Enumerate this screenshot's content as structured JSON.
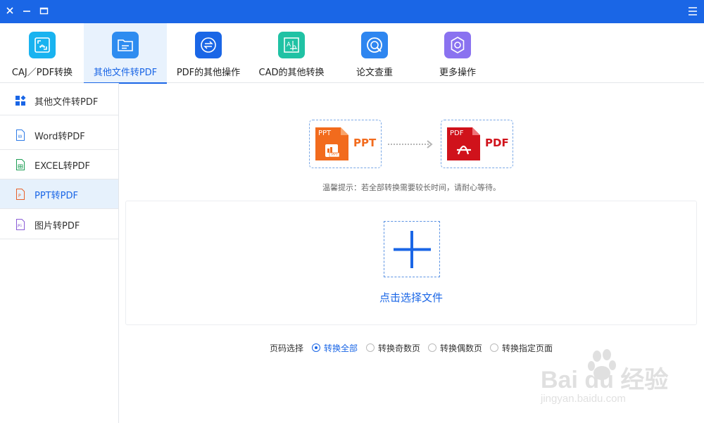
{
  "titlebar": {
    "background": "#1a66e6"
  },
  "toolbar": {
    "items": [
      {
        "label": "CAJ／PDF转换",
        "icon": "caj-pdf-convert-icon",
        "color": "#19b3f0"
      },
      {
        "label": "其他文件转PDF",
        "icon": "folder-file-icon",
        "color": "#2e8cf0",
        "active": true
      },
      {
        "label": "PDF的其他操作",
        "icon": "swap-arrows-icon",
        "color": "#1a66e6"
      },
      {
        "label": "CAD的其他转换",
        "icon": "cad-drawing-icon",
        "color": "#20c2a4"
      },
      {
        "label": "论文查重",
        "icon": "search-check-icon",
        "color": "#2e86f0"
      },
      {
        "label": "更多操作",
        "icon": "gear-icon",
        "color": "#8a72f0"
      }
    ]
  },
  "sidebar": {
    "items": [
      {
        "label": "其他文件转PDF",
        "icon": "grid-apps-icon"
      },
      {
        "label": "Word转PDF",
        "icon": "word-file-icon"
      },
      {
        "label": "EXCEL转PDF",
        "icon": "excel-file-icon"
      },
      {
        "label": "PPT转PDF",
        "icon": "ppt-file-icon",
        "active": true
      },
      {
        "label": "图片转PDF",
        "icon": "jpg-file-icon"
      }
    ]
  },
  "conversion": {
    "source": {
      "badge": "PPT",
      "sub_badge": "PPT",
      "label": "PPT",
      "color": "#f26b1d"
    },
    "target": {
      "badge": "PDF",
      "label": "PDF",
      "color": "#d0121b"
    }
  },
  "tip": "温馨提示：若全部转换需要较长时间，请耐心等待。",
  "drop": {
    "label": "点击选择文件"
  },
  "page_select": {
    "title": "页码选择",
    "options": [
      {
        "label": "转换全部",
        "checked": true
      },
      {
        "label": "转换奇数页",
        "checked": false
      },
      {
        "label": "转换偶数页",
        "checked": false
      },
      {
        "label": "转换指定页面",
        "checked": false
      }
    ]
  },
  "watermark": {
    "brand": "Bai du 经验",
    "url": "jingyan.baidu.com"
  }
}
